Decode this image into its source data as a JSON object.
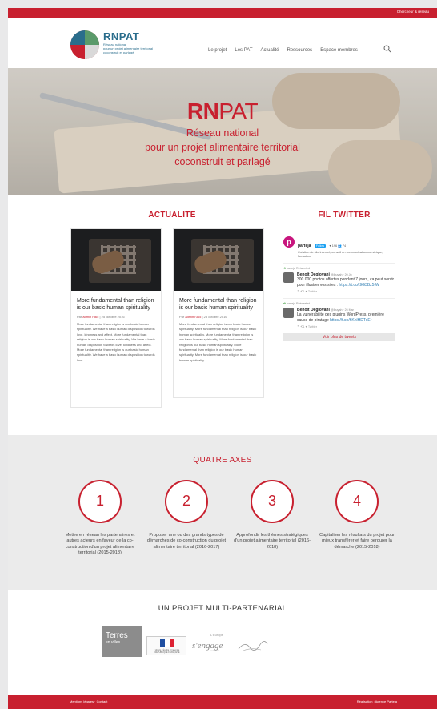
{
  "topbar": {
    "link": "Chercheur & réseau"
  },
  "brand": {
    "name": "RNPAT",
    "line1": "Réseau national",
    "line2": "pour un projet alimentaire territorial",
    "line3": "coconstruit et partagé"
  },
  "nav": {
    "items": [
      "Le projet",
      "Les PAT",
      "Actualité",
      "Ressources",
      "Espace membres"
    ]
  },
  "hero": {
    "title_bold": "RN",
    "title_rest": "PAT",
    "line1": "Réseau national",
    "line2": "pour un projet alimentaire territorial",
    "line3": "coconstruit et parlagé"
  },
  "news": {
    "heading": "ACTUALITE",
    "cards": [
      {
        "title": "More fundamental than religion is our basic human spirituality",
        "meta_prefix": "Par",
        "author": "admin r365",
        "date": "| 25 octobre 2016",
        "body": "More fundamental than religion is our basic human spirituality. We have a basic human disposition towards love, kindness and affect. More fundamental than religion is our basic human spirituality. We have a basic human disposition towards love, kindness and affect. More fundamental than religion is our basic human spirituality. We have a basic human disposition towards love..."
      },
      {
        "title": "More fundamental than religion is our basic human spirituality",
        "meta_prefix": "Par",
        "author": "admin r365",
        "date": "| 25 octobre 2016",
        "body": "More fundamental than religion is our basic human spirituality. More fundamental than religion is our basic human spirituality. More fundamental than religion is our basic human spirituality. More fundamental than religion is our basic human spirituality. More fundamental than religion is our basic human spirituality. More fundamental than religion is our basic human spirituality."
      }
    ]
  },
  "twitter": {
    "heading": "FIL TWITTER",
    "account_name": "parteja",
    "follow_label": "Follow",
    "stats": "♥ 196  👥 74",
    "description": "Création de site internet, conseil en communication numérique, formation",
    "tweets": [
      {
        "retweet": "parteja Retweeted",
        "author": "Benoit Deglovani",
        "handle": "@lbuyah · 20 Ju",
        "text": "300 000 photos offertes pendant 7 jours, ça peut servir pour illustrer vos sites : ",
        "link": "https://t.co/t9G3Bz5tW",
        "actions": "↰  ⟲1  ♥  Twitter"
      },
      {
        "retweet": "parteja Retweeted",
        "author": "Benoit Deglovani",
        "handle": "@lbuyah · 26 Mar",
        "text": "La vulnérabilité des plugins WordPress, première cause de piratage ",
        "link": "https://t.co/hKnlHDTxEr",
        "actions": "↰  ⟲1  ♥  Twitter"
      }
    ],
    "more_label": "Voir plus de tweets"
  },
  "axes": {
    "heading": "QUATRE AXES",
    "items": [
      {
        "number": "1",
        "text": "Mettre en réseau les partenaires et autres acteurs en faveur de la co-construction d'un projet alimentaire territorial (2015-2018)"
      },
      {
        "number": "2",
        "text": "Proposer une ou des grands types de démarches de co-construction du projet alimentaire territorial (2016-2017)"
      },
      {
        "number": "3",
        "text": "Approfondir les thèmes stratégiques d'un projet alimentaire territorial (2016-2018)"
      },
      {
        "number": "4",
        "text": "Capitaliser les résultats du projet pour mieux transférer et faire perdurer la démarche (2015-2018)"
      }
    ]
  },
  "partners": {
    "heading": "UN PROJET MULTI-PARTENARIAL",
    "terres_line1": "Terres",
    "terres_line2": "en villes",
    "gov_text": "Liberté • Égalité • Fraternité RÉPUBLIQUE FRANÇAISE",
    "engage_big": "s'engage",
    "engage_small": "L'Europe",
    "engage_tiny": "en France"
  },
  "footer": {
    "left": "Mentions légales · Contact",
    "right": "Réalisation : Agence Parteja"
  },
  "colors": {
    "accent": "#c8202f",
    "brand_blue": "#2a6d8c",
    "axes_bg": "#ebebeb"
  }
}
